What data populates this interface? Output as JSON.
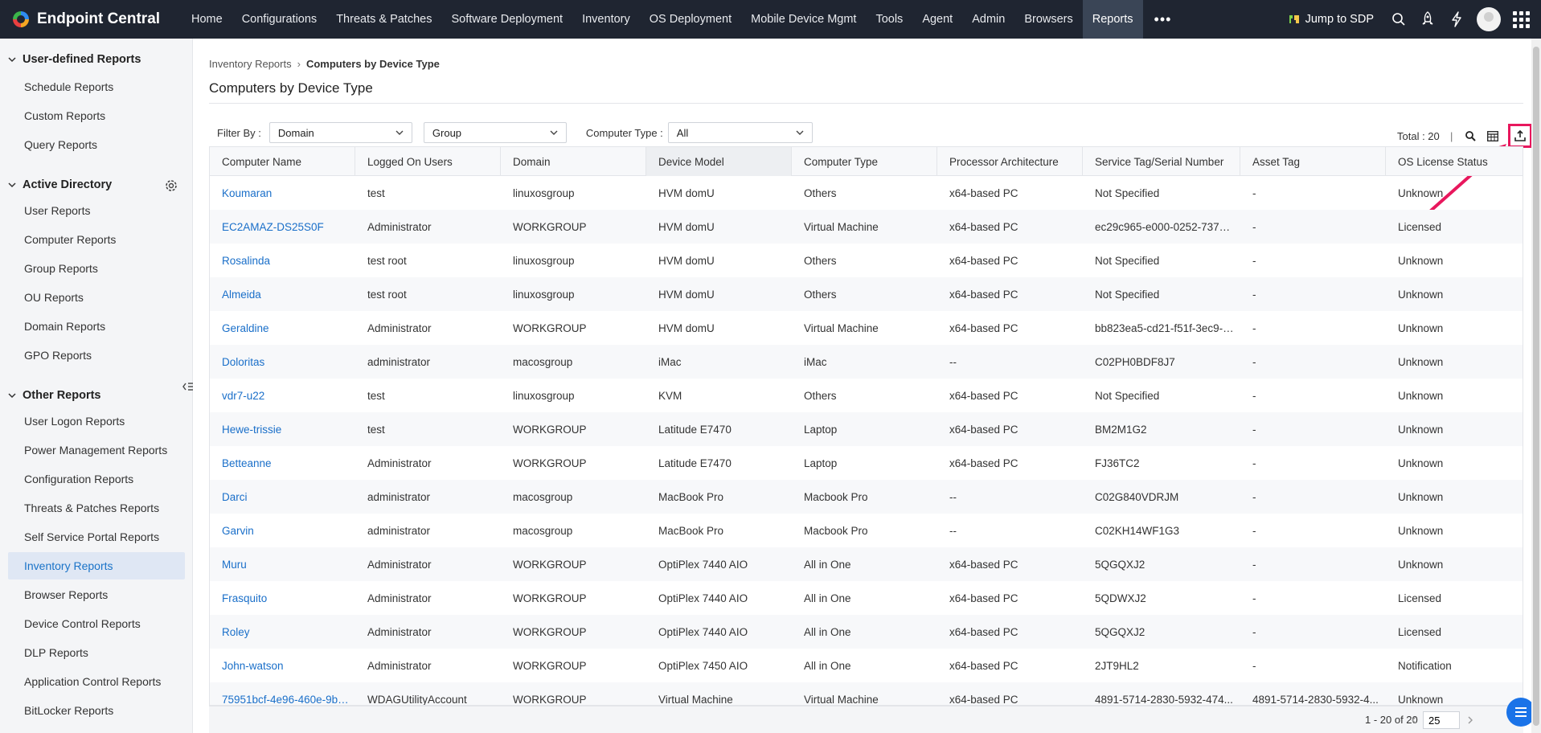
{
  "app": {
    "name": "Endpoint Central"
  },
  "nav": [
    {
      "label": "Home"
    },
    {
      "label": "Configurations"
    },
    {
      "label": "Threats & Patches"
    },
    {
      "label": "Software Deployment"
    },
    {
      "label": "Inventory"
    },
    {
      "label": "OS Deployment"
    },
    {
      "label": "Mobile Device Mgmt"
    },
    {
      "label": "Tools"
    },
    {
      "label": "Agent"
    },
    {
      "label": "Admin"
    },
    {
      "label": "Browsers"
    },
    {
      "label": "Reports",
      "active": true
    }
  ],
  "topbar": {
    "jump_label": "Jump to SDP"
  },
  "sidebar": {
    "sections": [
      {
        "title": "User-defined Reports",
        "items": [
          "Schedule Reports",
          "Custom Reports",
          "Query Reports"
        ]
      },
      {
        "title": "Active Directory",
        "items": [
          "User Reports",
          "Computer Reports",
          "Group Reports",
          "OU Reports",
          "Domain Reports",
          "GPO Reports"
        ]
      },
      {
        "title": "Other Reports",
        "items": [
          "User Logon Reports",
          "Power Management Reports",
          "Configuration Reports",
          "Threats & Patches Reports",
          "Self Service Portal Reports",
          "Inventory Reports",
          "Browser Reports",
          "Device Control Reports",
          "DLP Reports",
          "Application Control Reports",
          "BitLocker Reports"
        ]
      }
    ],
    "active_item": "Inventory Reports"
  },
  "breadcrumb": {
    "parent": "Inventory Reports",
    "current": "Computers by Device Type"
  },
  "page_title": "Computers by Device Type",
  "filters": {
    "label": "Filter By :",
    "domain": "Domain",
    "group": "Group",
    "computer_type_label": "Computer Type :",
    "computer_type": "All"
  },
  "toolbar": {
    "total": "Total : 20",
    "separator": "|"
  },
  "table": {
    "columns": [
      "Computer Name",
      "Logged On Users",
      "Domain",
      "Device Model",
      "Computer Type",
      "Processor Architecture",
      "Service Tag/Serial Number",
      "Asset Tag",
      "OS License Status"
    ],
    "rows": [
      [
        "Koumaran",
        "test",
        "linuxosgroup",
        "HVM domU",
        "Others",
        "x64-based PC",
        "Not Specified",
        "-",
        "Unknown"
      ],
      [
        "EC2AMAZ-DS25S0F",
        "Administrator",
        "WORKGROUP",
        "HVM domU",
        "Virtual Machine",
        "x64-based PC",
        "ec29c965-e000-0252-737a-...",
        "-",
        "Licensed"
      ],
      [
        "Rosalinda",
        "test root",
        "linuxosgroup",
        "HVM domU",
        "Others",
        "x64-based PC",
        "Not Specified",
        "-",
        "Unknown"
      ],
      [
        "Almeida",
        "test root",
        "linuxosgroup",
        "HVM domU",
        "Others",
        "x64-based PC",
        "Not Specified",
        "-",
        "Unknown"
      ],
      [
        "Geraldine",
        "Administrator",
        "WORKGROUP",
        "HVM domU",
        "Virtual Machine",
        "x64-based PC",
        "bb823ea5-cd21-f51f-3ec9-8...",
        "-",
        "Unknown"
      ],
      [
        "Doloritas",
        "administrator",
        "macosgroup",
        "iMac",
        "iMac",
        "--",
        "C02PH0BDF8J7",
        "-",
        "Unknown"
      ],
      [
        "vdr7-u22",
        "test",
        "linuxosgroup",
        "KVM",
        "Others",
        "x64-based PC",
        "Not Specified",
        "-",
        "Unknown"
      ],
      [
        "Hewe-trissie",
        "test",
        "WORKGROUP",
        "Latitude E7470",
        "Laptop",
        "x64-based PC",
        "BM2M1G2",
        "-",
        "Unknown"
      ],
      [
        "Betteanne",
        "Administrator",
        "WORKGROUP",
        "Latitude E7470",
        "Laptop",
        "x64-based PC",
        "FJ36TC2",
        "-",
        "Unknown"
      ],
      [
        "Darci",
        "administrator",
        "macosgroup",
        "MacBook Pro",
        "Macbook Pro",
        "--",
        "C02G840VDRJM",
        "-",
        "Unknown"
      ],
      [
        "Garvin",
        "administrator",
        "macosgroup",
        "MacBook Pro",
        "Macbook Pro",
        "--",
        "C02KH14WF1G3",
        "-",
        "Unknown"
      ],
      [
        "Muru",
        "Administrator",
        "WORKGROUP",
        "OptiPlex 7440 AIO",
        "All in One",
        "x64-based PC",
        "5QGQXJ2",
        "-",
        "Unknown"
      ],
      [
        "Frasquito",
        "Administrator",
        "WORKGROUP",
        "OptiPlex 7440 AIO",
        "All in One",
        "x64-based PC",
        "5QDWXJ2",
        "-",
        "Licensed"
      ],
      [
        "Roley",
        "Administrator",
        "WORKGROUP",
        "OptiPlex 7440 AIO",
        "All in One",
        "x64-based PC",
        "5QGQXJ2",
        "-",
        "Licensed"
      ],
      [
        "John-watson",
        "Administrator",
        "WORKGROUP",
        "OptiPlex 7450 AIO",
        "All in One",
        "x64-based PC",
        "2JT9HL2",
        "-",
        "Notification"
      ],
      [
        "75951bcf-4e96-460e-9b6...",
        "WDAGUtilityAccount",
        "WORKGROUP",
        "Virtual Machine",
        "Virtual Machine",
        "x64-based PC",
        "4891-5714-2830-5932-474...",
        "4891-5714-2830-5932-4...",
        "Unknown"
      ]
    ]
  },
  "pagination": {
    "range": "1 - 20 of 20",
    "per_page": "25"
  },
  "colors": {
    "topbar": "#1f2531",
    "link": "#1a6fc9",
    "highlight": "#e8175d",
    "active_nav": "#3a4556"
  },
  "icons": [
    "search-icon",
    "rocket-icon",
    "lightning-icon",
    "apps-grid-icon",
    "gear-icon",
    "column-chooser-icon",
    "export-icon",
    "chat-icon"
  ]
}
